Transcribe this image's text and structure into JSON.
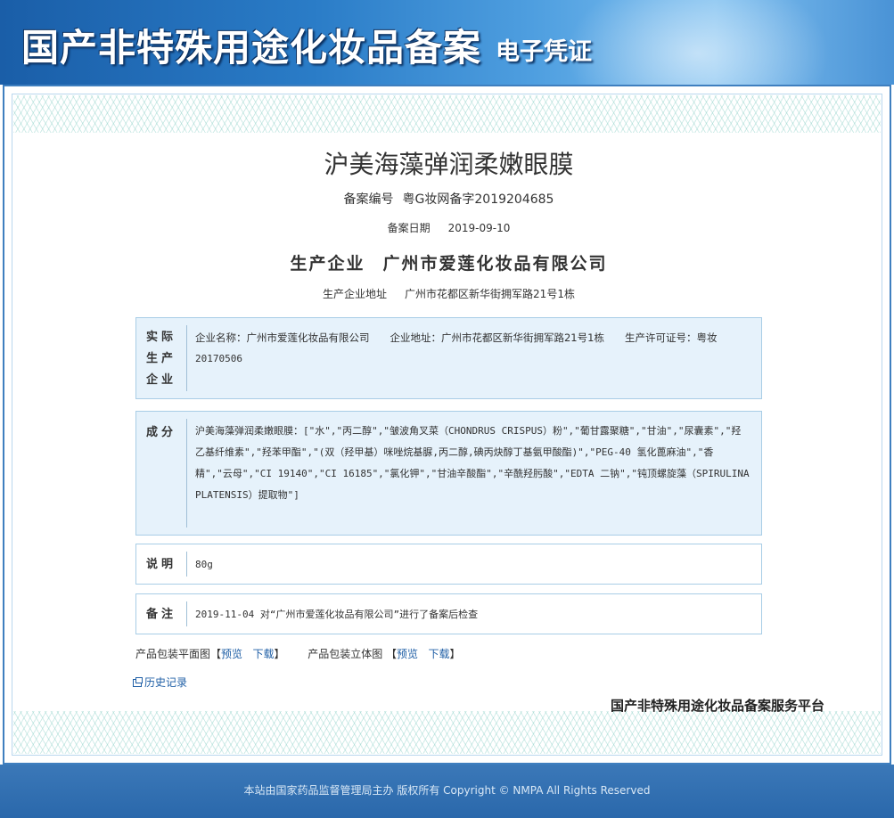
{
  "banner": {
    "title": "国产非特殊用途化妆品备案",
    "subtitle": "电子凭证"
  },
  "product": {
    "name": "沪美海藻弹润柔嫩眼膜",
    "record_no_label": "备案编号",
    "record_no": "粤G妆网备字2019204685",
    "record_date_label": "备案日期",
    "record_date": "2019-09-10",
    "producer_label": "生产企业",
    "producer": "广州市爱莲化妆品有限公司",
    "address_label": "生产企业地址",
    "address": "广州市花都区新华街拥军路21号1栋"
  },
  "actual_producer": {
    "label_lines": [
      "实际",
      "生产",
      "企业"
    ],
    "line1": "企业名称：广州市爱莲化妆品有限公司　　企业地址：广州市花都区新华街拥军路21号1栋　　生产许可证号：粤妆",
    "line2": "20170506"
  },
  "ingredients": {
    "label": "成分",
    "text": "沪美海藻弹润柔嫩眼膜：[\"水\",\"丙二醇\",\"皱波角叉菜（CHONDRUS CRISPUS）粉\",\"葡甘露聚糖\",\"甘油\",\"尿囊素\",\"羟乙基纤维素\",\"羟苯甲酯\",\"(双（羟甲基）咪唑烷基脲,丙二醇,碘丙炔醇丁基氨甲酸酯)\",\"PEG-40 氢化蓖麻油\",\"香精\",\"云母\",\"CI 19140\",\"CI 16185\",\"氯化钾\",\"甘油辛酸酯\",\"辛酰羟肟酸\",\"EDTA 二钠\",\"钝顶螺旋藻（SPIRULINA PLATENSIS）提取物\"]"
  },
  "description": {
    "label": "说明",
    "text": "80g"
  },
  "remark": {
    "label": "备注",
    "text": "2019-11-04 对“广州市爱莲化妆品有限公司”进行了备案后检查"
  },
  "package": {
    "flat_label": "产品包装平面图",
    "solid_label": "产品包装立体图",
    "preview": "预览",
    "download": "下载",
    "bracket_open": "【",
    "bracket_close": "】"
  },
  "history": {
    "label": "历史记录",
    "icon": "history-icon"
  },
  "platform_name": "国产非特殊用途化妆品备案服务平台",
  "footer": {
    "text": "本站由国家药品监督管理局主办 版权所有 Copyright © NMPA All Rights Reserved"
  },
  "colors": {
    "banner_blue": "#2a7cc7",
    "frame_border": "#3f7fbf",
    "box_bg": "#e6f2fb",
    "box_border": "#a8cde6",
    "link": "#1f5fa6",
    "footer_bg": "#2a68ab"
  }
}
